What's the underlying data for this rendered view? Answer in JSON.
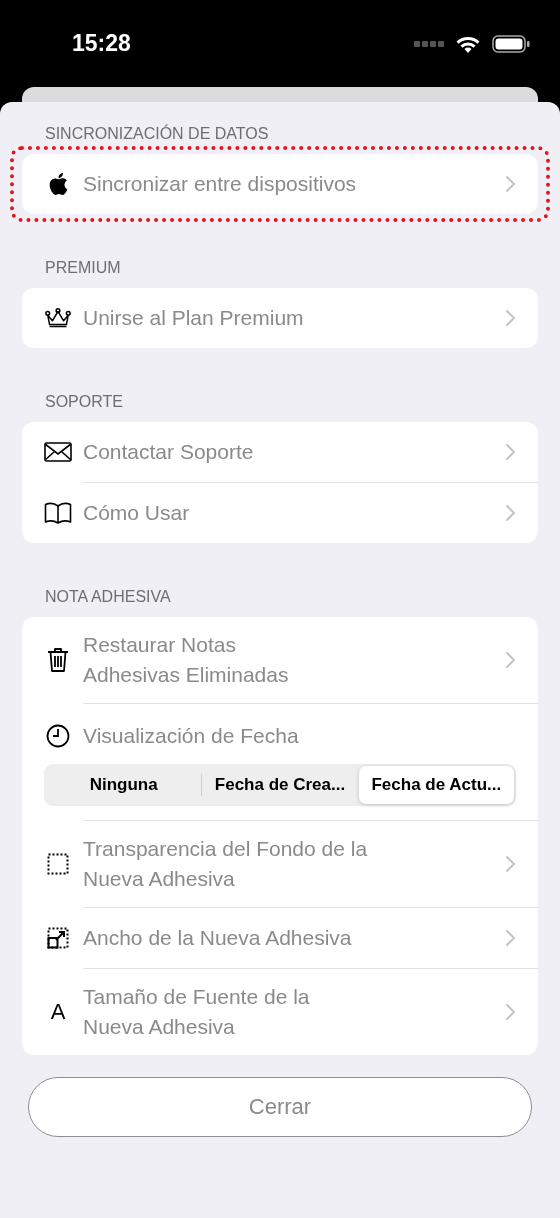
{
  "status_bar": {
    "time": "15:28"
  },
  "sections": [
    {
      "header": "SINCRONIZACIÓN DE DATOS",
      "rows": [
        {
          "kind": "link",
          "label": "Sincronizar entre dispositivos",
          "highlighted": true
        }
      ]
    },
    {
      "header": "PREMIUM",
      "rows": [
        {
          "kind": "link",
          "label": "Unirse al Plan Premium",
          "highlighted": false
        }
      ]
    },
    {
      "header": "SOPORTE",
      "rows": [
        {
          "kind": "link",
          "label": "Contactar Soporte",
          "highlighted": false
        },
        {
          "kind": "link",
          "label": "Cómo Usar",
          "highlighted": false
        }
      ]
    },
    {
      "header": "NOTA ADHESIVA",
      "rows": [
        {
          "kind": "link",
          "label": "Restaurar Notas\nAdhesivas Eliminadas",
          "highlighted": false
        },
        {
          "kind": "choice",
          "label": "Visualización de Fecha",
          "highlighted": false,
          "options": [
            {
              "label": "Ninguna",
              "selected": false
            },
            {
              "label": "Fecha de Crea...",
              "selected": false
            },
            {
              "label": "Fecha de Actu...",
              "selected": true
            }
          ]
        },
        {
          "kind": "link",
          "label": "Transparencia del Fondo de la\nNueva Adhesiva",
          "highlighted": false
        },
        {
          "kind": "link",
          "label": "Ancho de la Nueva Adhesiva",
          "highlighted": false
        },
        {
          "kind": "link",
          "glyph": "A",
          "label": "Tamaño de Fuente de la\nNueva Adhesiva",
          "highlighted": false
        }
      ]
    }
  ],
  "close_button": {
    "label": "Cerrar"
  }
}
